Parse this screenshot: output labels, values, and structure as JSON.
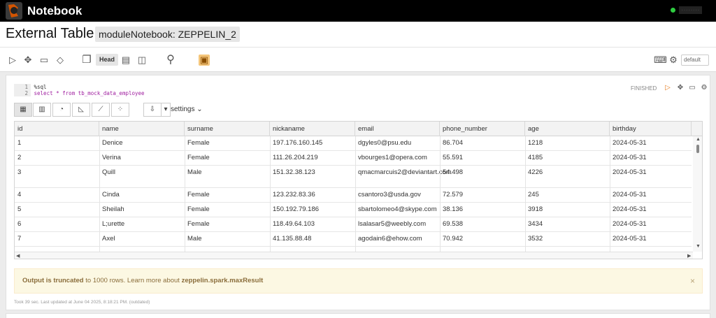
{
  "app": {
    "name": "Notebook"
  },
  "header": {
    "user": "········"
  },
  "title": {
    "text": "External Table",
    "chip": "moduleNotebook: ZEPPELIN_2"
  },
  "toolbar": {
    "head_label": "Head",
    "interpreter_default": "default"
  },
  "paragraph": {
    "status": "FINISHED",
    "code_lines": [
      "%sql",
      "select * from tb_mock_data_employee"
    ],
    "settings_label": "settings"
  },
  "table": {
    "columns": [
      "id",
      "name",
      "surname",
      "nickaname",
      "email",
      "phone_number",
      "age",
      "birthday"
    ],
    "rows": [
      [
        "1",
        "Denice",
        "Female",
        "197.176.160.145",
        "dgyles0@psu.edu",
        "86.704",
        "1218",
        "2024-05-31"
      ],
      [
        "2",
        "Verina",
        "Female",
        "111.26.204.219",
        "vbourges1@opera.com",
        "55.591",
        "4185",
        "2024-05-31"
      ],
      [
        "3",
        "Quill",
        "Male",
        "151.32.38.123",
        "qmacmarcuis2@deviantart.com",
        "54.498",
        "4226",
        "2024-05-31"
      ],
      [
        "4",
        "Cinda",
        "Female",
        "123.232.83.36",
        "csantoro3@usda.gov",
        "72.579",
        "245",
        "2024-05-31"
      ],
      [
        "5",
        "Sheilah",
        "Female",
        "150.192.79.186",
        "sbartolomeo4@skype.com",
        "38.136",
        "3918",
        "2024-05-31"
      ],
      [
        "6",
        "L;urette",
        "Female",
        "118.49.64.103",
        "lsalasar5@weebly.com",
        "69.538",
        "3434",
        "2024-05-31"
      ],
      [
        "7",
        "Axel",
        "Male",
        "41.135.88.48",
        "agodain6@ehow.com",
        "70.942",
        "3532",
        "2024-05-31"
      ]
    ]
  },
  "notice": {
    "bold1": "Output is truncated",
    "text1": " to 1000 rows. Learn more about ",
    "bold2": "zeppelin.spark.maxResult",
    "close": "×"
  },
  "footer": {
    "text": "Took 39 sec. Last updated at June 04 2025, 8:18:21 PM. (outdated)"
  },
  "icons": [
    "run-icon",
    "hide-code-icon",
    "book-icon",
    "eraser-icon",
    "clone-icon",
    "export-icon",
    "layout-icon",
    "search-icon",
    "schedule-icon",
    "keyboard-icon",
    "gear-icon"
  ]
}
